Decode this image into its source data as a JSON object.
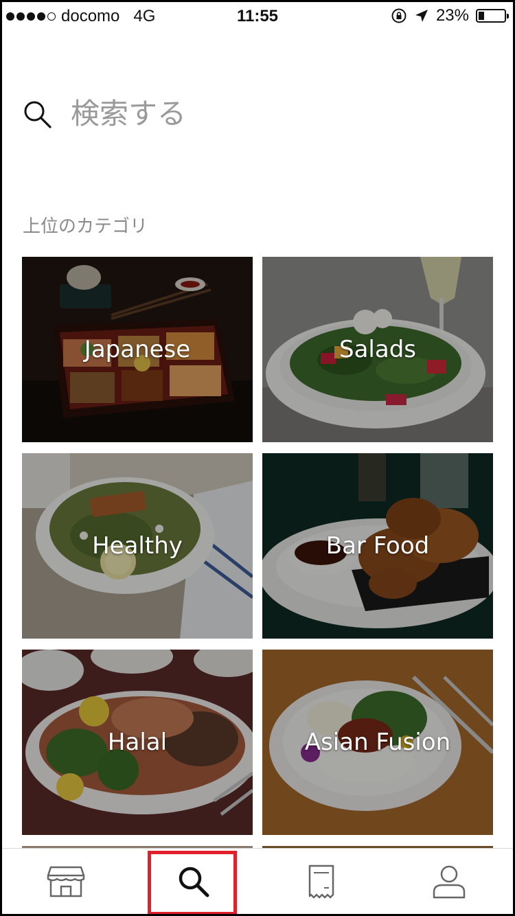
{
  "status_bar": {
    "carrier": "docomo",
    "network": "4G",
    "time": "11:55",
    "battery": "23%",
    "battery_level": 0.23,
    "signal_dots_filled": 4,
    "signal_dots_total": 5
  },
  "search": {
    "placeholder": "検索する"
  },
  "section": {
    "title": "上位のカテゴリ"
  },
  "categories": [
    {
      "label": "Japanese"
    },
    {
      "label": "Salads"
    },
    {
      "label": "Healthy"
    },
    {
      "label": "Bar Food"
    },
    {
      "label": "Halal"
    },
    {
      "label": "Asian Fusion"
    }
  ],
  "tab_bar": {
    "tabs": [
      {
        "icon": "store-icon"
      },
      {
        "icon": "search-icon",
        "selected": true
      },
      {
        "icon": "receipt-icon"
      },
      {
        "icon": "account-icon"
      }
    ],
    "highlight_color": "#e0202a"
  }
}
